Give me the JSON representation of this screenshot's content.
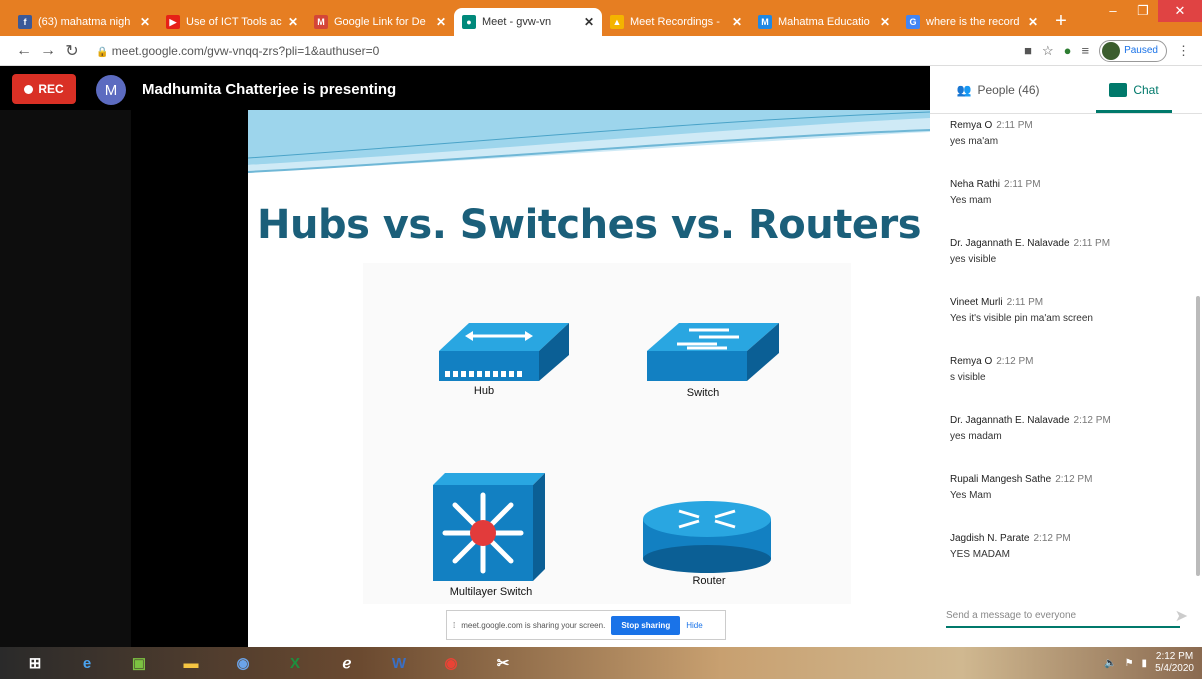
{
  "tabs": [
    {
      "label": "(63) mahatma nigh",
      "icon": "facebook-icon",
      "color": "#3b5998",
      "glyph": "f",
      "active": false
    },
    {
      "label": "Use of ICT Tools ac",
      "icon": "youtube-icon",
      "color": "#e62117",
      "glyph": "▶",
      "active": false
    },
    {
      "label": "Google Link for De",
      "icon": "gmail-icon",
      "color": "#d44638",
      "glyph": "M",
      "active": false
    },
    {
      "label": "Meet - gvw-vn",
      "icon": "meet-icon",
      "color": "#00897b",
      "glyph": "●",
      "active": true
    },
    {
      "label": "Meet Recordings -",
      "icon": "drive-icon",
      "color": "#f4b400",
      "glyph": "▲",
      "active": false
    },
    {
      "label": "Mahatma Educatio",
      "icon": "site-icon",
      "color": "#1e88e5",
      "glyph": "M",
      "active": false
    },
    {
      "label": "where is the record",
      "icon": "google-icon",
      "color": "#4285f4",
      "glyph": "G",
      "active": false
    }
  ],
  "address": {
    "url": "meet.google.com/gvw-vnqq-zrs?pli=1&authuser=0",
    "paused_label": "Paused"
  },
  "meet": {
    "rec_label": "REC",
    "presenter_initial": "M",
    "presenting_text": "Madhumita Chatterjee is presenting"
  },
  "slide": {
    "title": "Hubs vs. Switches vs. Routers",
    "devices": [
      "Hub",
      "Switch",
      "Multilayer Switch",
      "Router"
    ]
  },
  "sharebar": {
    "text": "meet.google.com is sharing your screen.",
    "stop_label": "Stop sharing",
    "hide_label": "Hide"
  },
  "panel": {
    "people_label": "People (46)",
    "chat_label": "Chat",
    "messages": [
      {
        "name": "Remya O",
        "time": "2:11 PM",
        "text": "yes ma'am"
      },
      {
        "name": "Neha Rathi",
        "time": "2:11 PM",
        "text": "Yes mam"
      },
      {
        "name": "Dr. Jagannath E. Nalavade",
        "time": "2:11 PM",
        "text": "yes visible"
      },
      {
        "name": "Vineet Murli",
        "time": "2:11 PM",
        "text": "Yes it's visible pin ma'am screen"
      },
      {
        "name": "Remya O",
        "time": "2:12 PM",
        "text": "s visible"
      },
      {
        "name": "Dr. Jagannath E. Nalavade",
        "time": "2:12 PM",
        "text": "yes madam"
      },
      {
        "name": "Rupali Mangesh Sathe",
        "time": "2:12 PM",
        "text": "Yes Mam"
      },
      {
        "name": "Jagdish N. Parate",
        "time": "2:12 PM",
        "text": "YES MADAM"
      }
    ],
    "compose_placeholder": "Send a message to everyone"
  },
  "taskbar": {
    "apps": [
      "windows-start-icon",
      "ie-icon",
      "store-icon",
      "file-explorer-icon",
      "chrome-canary-icon",
      "excel-icon",
      "edge-icon",
      "word-icon",
      "chrome-icon",
      "snipping-icon"
    ],
    "time": "2:12 PM",
    "date": "5/4/2020"
  }
}
